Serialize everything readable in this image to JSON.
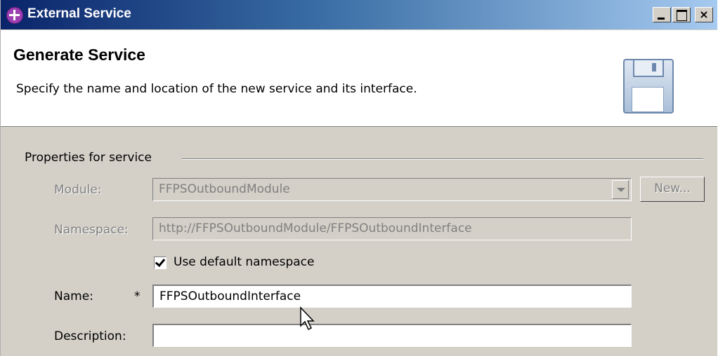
{
  "window": {
    "title": "External Service",
    "controls": {
      "minimize": "_",
      "maximize": "□",
      "close": "×"
    }
  },
  "header": {
    "title": "Generate Service",
    "description": "Specify the name and location of the new service and its interface.",
    "icon": "floppy-disk-icon"
  },
  "properties": {
    "group_title": "Properties for service",
    "module": {
      "label": "Module:",
      "value": "FFPSOutboundModule",
      "new_button": "New..."
    },
    "namespace": {
      "label": "Namespace:",
      "value": "http://FFPSOutboundModule/FFPSOutboundInterface"
    },
    "use_default_namespace": {
      "label": "Use default namespace",
      "checked": true
    },
    "name": {
      "label": "Name:",
      "required_marker": "*",
      "value": "FFPSOutboundInterface"
    },
    "description": {
      "label": "Description:",
      "value": ""
    }
  },
  "colors": {
    "titlebar_start": "#0a246a",
    "titlebar_end": "#a6caf0",
    "dialog_bg": "#d4d0c8",
    "disabled_text": "#808080"
  }
}
